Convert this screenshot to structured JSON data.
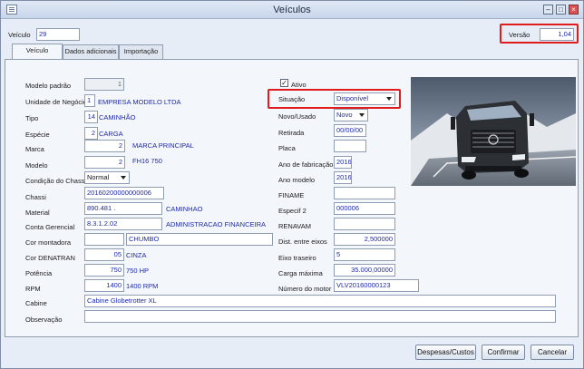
{
  "window": {
    "title": "Veículos"
  },
  "header": {
    "veiculo_label": "Veículo",
    "veiculo_value": "29",
    "versao_label": "Versão",
    "versao_value": "1,04"
  },
  "tabs": [
    {
      "label": "Veículo"
    },
    {
      "label": "Dados adicionais"
    },
    {
      "label": "Importação"
    }
  ],
  "left": {
    "modelo_padrao": {
      "label": "Modelo padrão",
      "value": "1"
    },
    "unidade": {
      "label": "Unidade de Negócio",
      "code": "1",
      "name": "EMPRESA MODELO LTDA"
    },
    "tipo": {
      "label": "Tipo",
      "code": "14",
      "name": "CAMINHÃO"
    },
    "especie": {
      "label": "Espécie",
      "code": "2",
      "name": "CARGA"
    },
    "marca": {
      "label": "Marca",
      "code": "2",
      "name": "MARCA PRINCIPAL"
    },
    "modelo": {
      "label": "Modelo",
      "code": "2",
      "name": "FH16 750"
    },
    "condicao": {
      "label": "Condição do Chassi",
      "value": "Normal"
    },
    "chassi": {
      "label": "Chassi",
      "value": "20160200000000006"
    },
    "material": {
      "label": "Material",
      "code": "890.481 .",
      "name": "CAMINHAO"
    },
    "conta": {
      "label": "Conta Gerencial",
      "code": "8.3.1.2.02",
      "name": "ADMINISTRACAO FINANCEIRA"
    },
    "cor_montadora": {
      "label": "Cor montadora",
      "code": "",
      "name": "CHUMBO"
    },
    "cor_denatran": {
      "label": "Cor DENATRAN",
      "code": "05",
      "name": "CINZA"
    },
    "potencia": {
      "label": "Potência",
      "code": "750",
      "name": "750 HP"
    },
    "rpm": {
      "label": "RPM",
      "code": "1400",
      "name": "1400 RPM"
    },
    "cabine": {
      "label": "Cabine",
      "value": "Cabine Globetrotter XL"
    },
    "observacao": {
      "label": "Observação",
      "value": ""
    }
  },
  "right": {
    "ativo": {
      "label": "Ativo",
      "checked": true
    },
    "situacao": {
      "label": "Situação",
      "value": "Disponível"
    },
    "novo_usado": {
      "label": "Novo/Usado",
      "value": "Novo"
    },
    "retirada": {
      "label": "Retirada",
      "value": "00/00/00"
    },
    "placa": {
      "label": "Placa",
      "value": ""
    },
    "ano_fabricacao": {
      "label": "Ano de fabricação",
      "value": "2016"
    },
    "ano_modelo": {
      "label": "Ano modelo",
      "value": "2016"
    },
    "finame": {
      "label": "FINAME",
      "value": ""
    },
    "especif2": {
      "label": "Especif 2",
      "value": "000006"
    },
    "renavam": {
      "label": "RENAVAM",
      "value": ""
    },
    "dist_eixos": {
      "label": "Dist. entre eixos",
      "value": "2,500000"
    },
    "eixo_traseiro": {
      "label": "Eixo traseiro",
      "value": "5"
    },
    "carga_maxima": {
      "label": "Carga máxima",
      "value": "35.000,00000"
    },
    "numero_motor": {
      "label": "Número do motor",
      "value": "VLV20160000123"
    }
  },
  "footer": {
    "despesas": "Despesas/Custos",
    "confirmar": "Confirmar",
    "cancelar": "Cancelar"
  }
}
